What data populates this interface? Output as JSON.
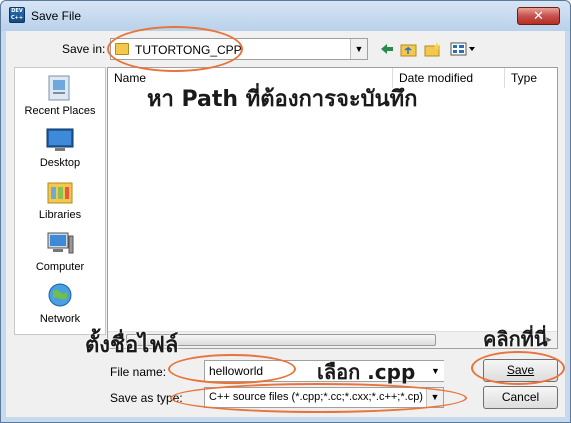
{
  "window": {
    "title": "Save File",
    "app_icon_text": "DEV C++",
    "close_glyph": "✕"
  },
  "toolbar": {
    "save_in_label": "Save in:",
    "save_in_value": "TUTORTONG_CPP",
    "combo_arrow": "▼",
    "icons": [
      "back-icon",
      "up-folder-icon",
      "new-folder-icon",
      "view-menu-icon"
    ]
  },
  "places": [
    {
      "label": "Recent Places",
      "icon": "recent-places-icon"
    },
    {
      "label": "Desktop",
      "icon": "desktop-icon"
    },
    {
      "label": "Libraries",
      "icon": "libraries-icon"
    },
    {
      "label": "Computer",
      "icon": "computer-icon"
    },
    {
      "label": "Network",
      "icon": "network-icon"
    }
  ],
  "columns": [
    "Name",
    "Date modified",
    "Type"
  ],
  "file_name_label": "File name:",
  "file_name_value": "helloworld",
  "save_as_label": "Save as type:",
  "save_as_value": "C++ source files (*.cpp;*.cc;*.cxx;*.c++;*.cp)",
  "buttons": {
    "save": "Save",
    "cancel": "Cancel"
  },
  "annotations": {
    "path": "หา Path ที่ต้องการจะบันทึก",
    "filename": "ตั้งชื่อไฟล์",
    "cpp": "เลือก .cpp",
    "click": "คลิกที่นี่"
  },
  "colors": {
    "annotation_outline": "#e8743b",
    "close_button": "#c75050"
  }
}
